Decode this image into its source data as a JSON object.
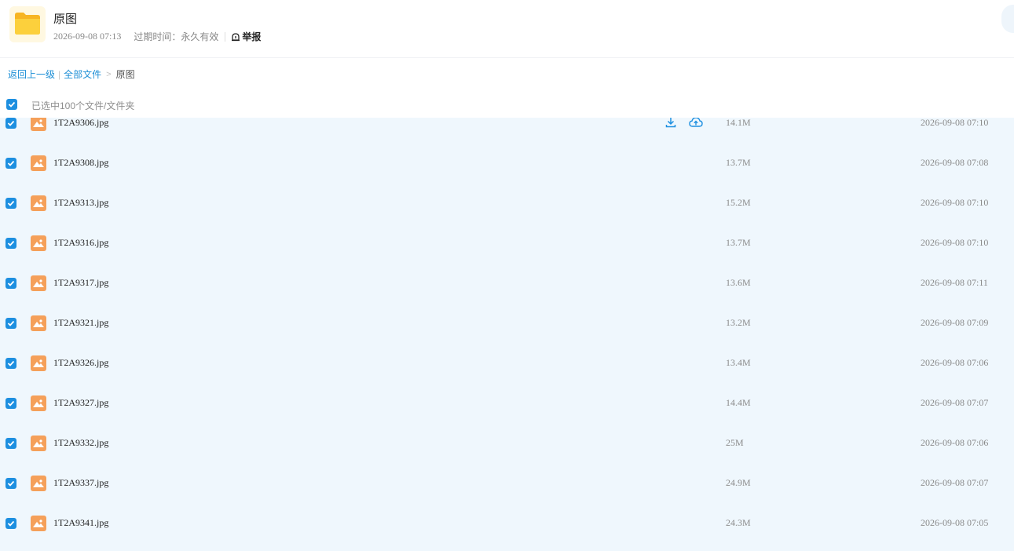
{
  "header": {
    "title": "原图",
    "created": "2026-09-08 07:13",
    "expire_label": "过期时间：",
    "expire_value": "永久有效",
    "report_label": "举报"
  },
  "breadcrumb": {
    "back": "返回上一级",
    "all_files": "全部文件",
    "separator": ">",
    "current": "原图"
  },
  "selection": {
    "label": "已选中100个文件/文件夹"
  },
  "colors": {
    "accent": "#1d8fe0",
    "file_icon": "#f5a05a",
    "list_bg": "#eff7fd",
    "folder": "#fcc934"
  },
  "files": [
    {
      "name": "1T2A9306.jpg",
      "size": "14.1M",
      "date": "2026-09-08 07:10"
    },
    {
      "name": "1T2A9308.jpg",
      "size": "13.7M",
      "date": "2026-09-08 07:08"
    },
    {
      "name": "1T2A9313.jpg",
      "size": "15.2M",
      "date": "2026-09-08 07:10"
    },
    {
      "name": "1T2A9316.jpg",
      "size": "13.7M",
      "date": "2026-09-08 07:10"
    },
    {
      "name": "1T2A9317.jpg",
      "size": "13.6M",
      "date": "2026-09-08 07:11"
    },
    {
      "name": "1T2A9321.jpg",
      "size": "13.2M",
      "date": "2026-09-08 07:09"
    },
    {
      "name": "1T2A9326.jpg",
      "size": "13.4M",
      "date": "2026-09-08 07:06"
    },
    {
      "name": "1T2A9327.jpg",
      "size": "14.4M",
      "date": "2026-09-08 07:07"
    },
    {
      "name": "1T2A9332.jpg",
      "size": "25M",
      "date": "2026-09-08 07:06"
    },
    {
      "name": "1T2A9337.jpg",
      "size": "24.9M",
      "date": "2026-09-08 07:07"
    },
    {
      "name": "1T2A9341.jpg",
      "size": "24.3M",
      "date": "2026-09-08 07:05"
    }
  ]
}
